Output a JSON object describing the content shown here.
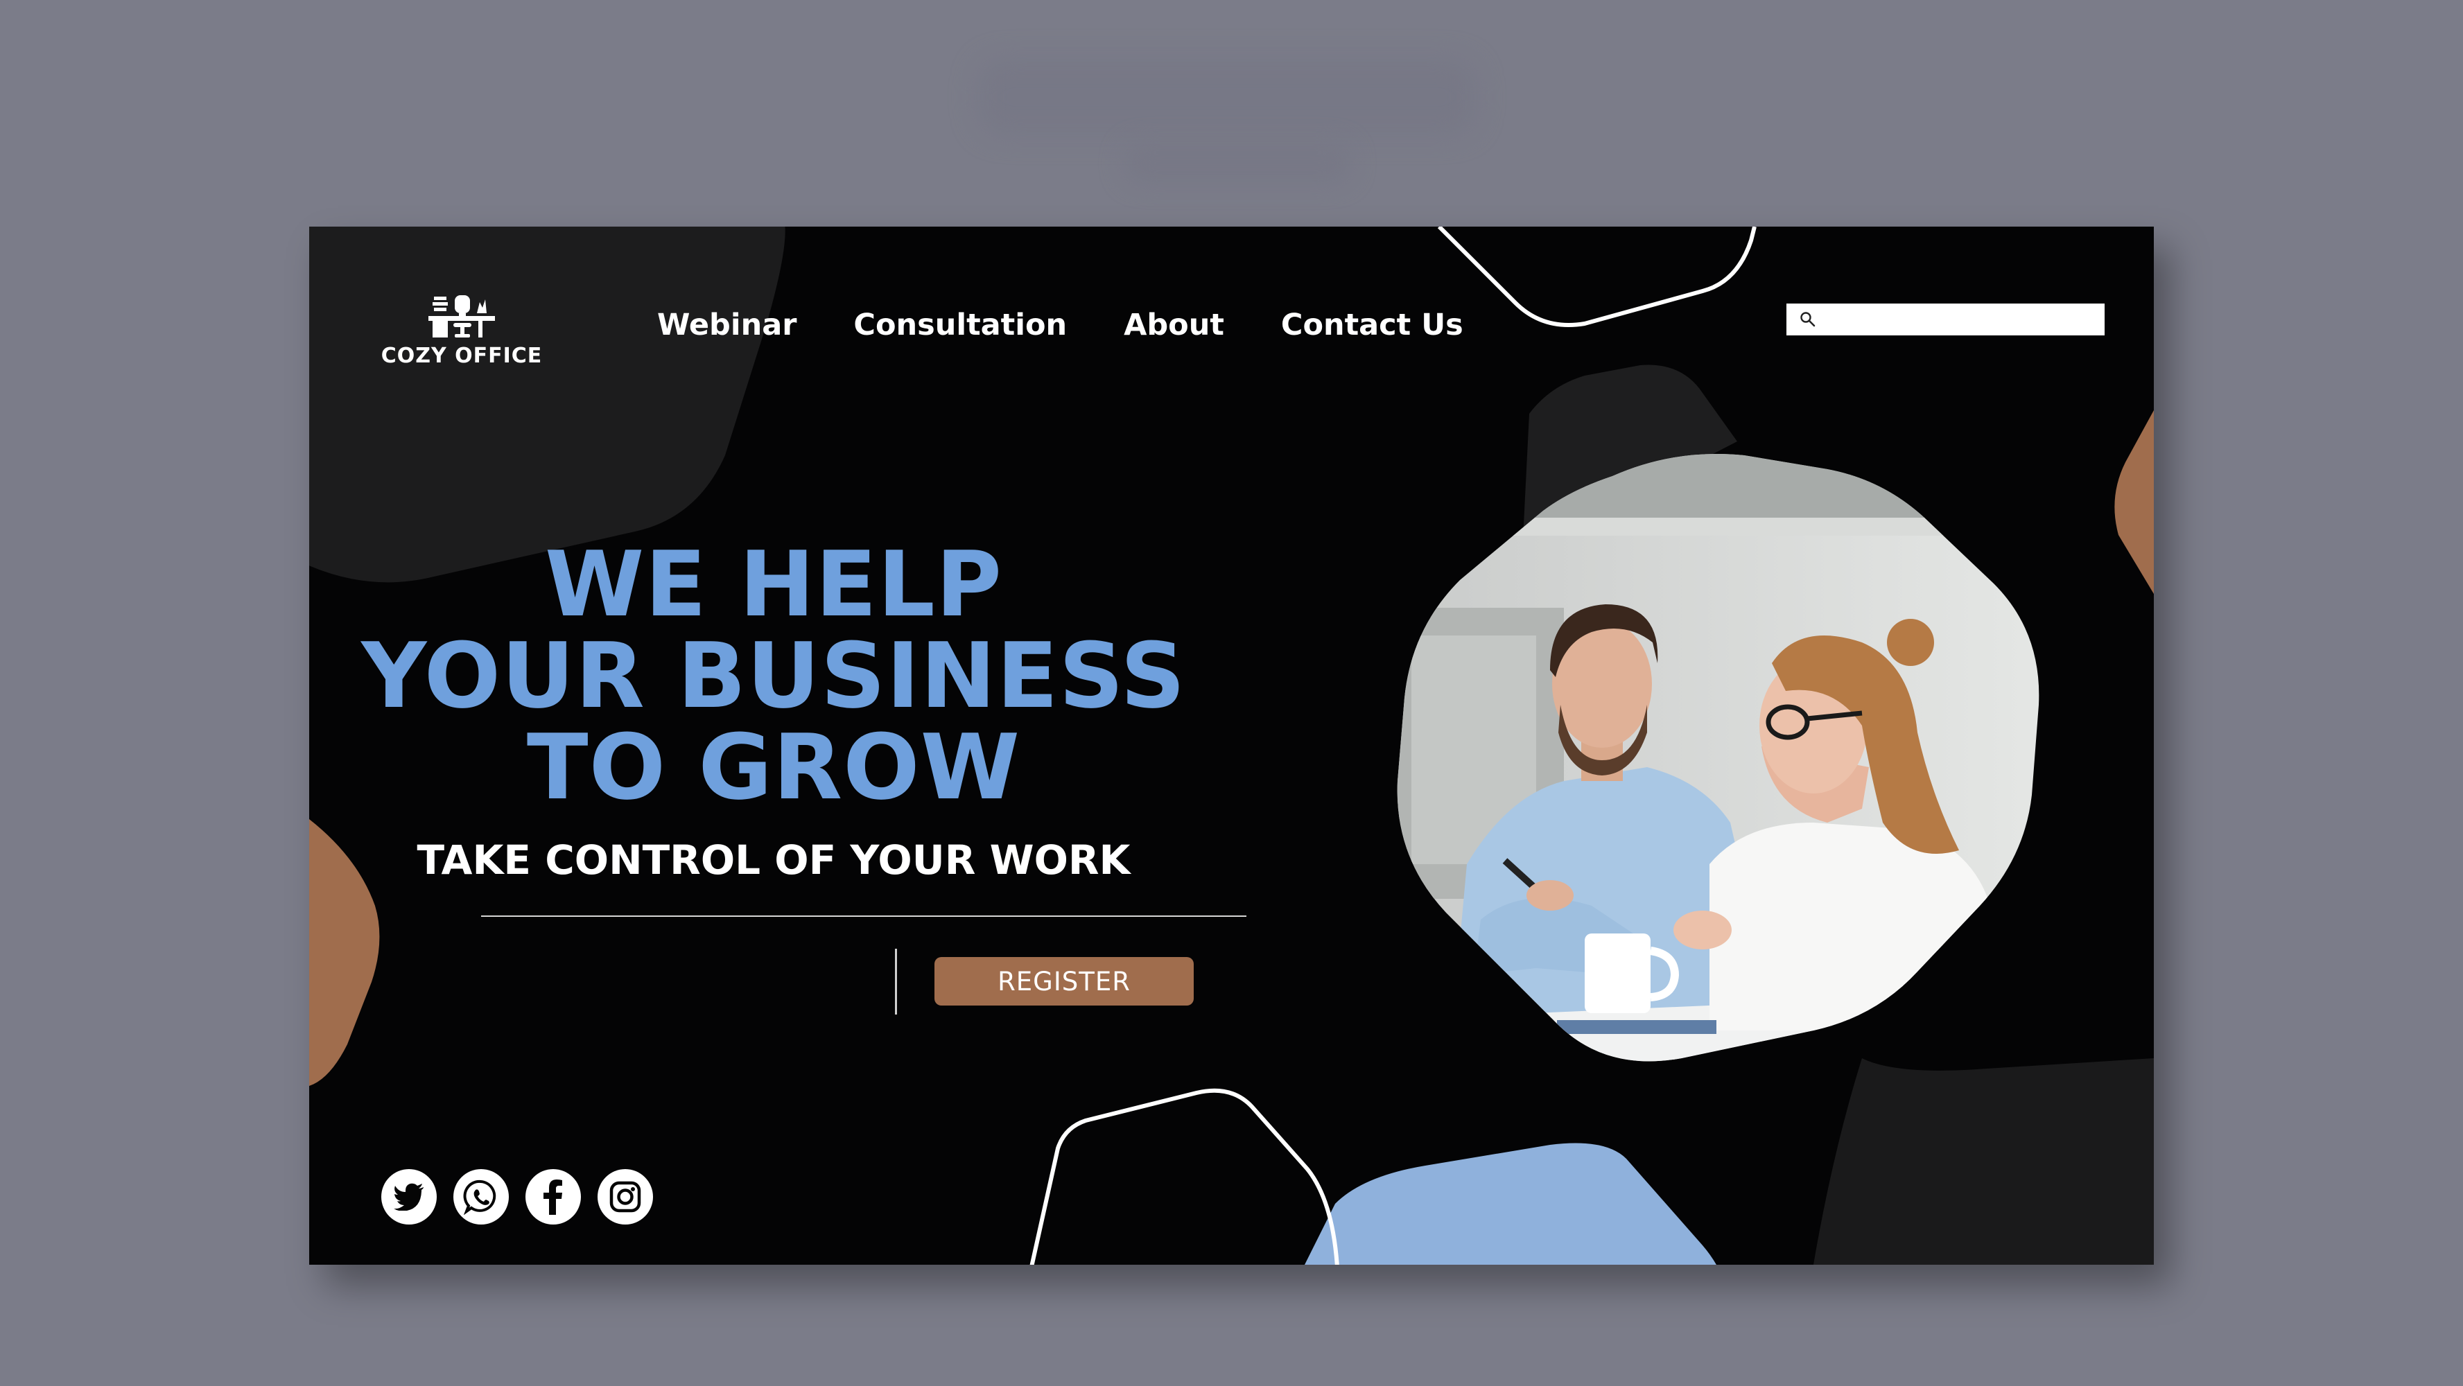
{
  "brand": {
    "name": "COZY OFFICE",
    "logo_icon": "desk-chair-icon"
  },
  "nav": {
    "items": [
      {
        "label": "Webinar"
      },
      {
        "label": "Consultation"
      },
      {
        "label": "About"
      },
      {
        "label": "Contact Us"
      }
    ]
  },
  "search": {
    "icon": "search-icon",
    "placeholder": ""
  },
  "hero": {
    "headline_lines": [
      "WE HELP",
      "YOUR BUSINESS",
      "TO GROW"
    ],
    "subheadline": "TAKE CONTROL OF YOUR WORK",
    "register_label": "REGISTER"
  },
  "social": [
    "twitter-icon",
    "whatsapp-icon",
    "facebook-icon",
    "instagram-icon"
  ],
  "colors": {
    "background": "#040405",
    "accent_blue": "#6fa0dd",
    "accent_brown": "#a06d4d",
    "panel_dark": "#1a1a1b",
    "page_grey": "#7b7c89"
  }
}
